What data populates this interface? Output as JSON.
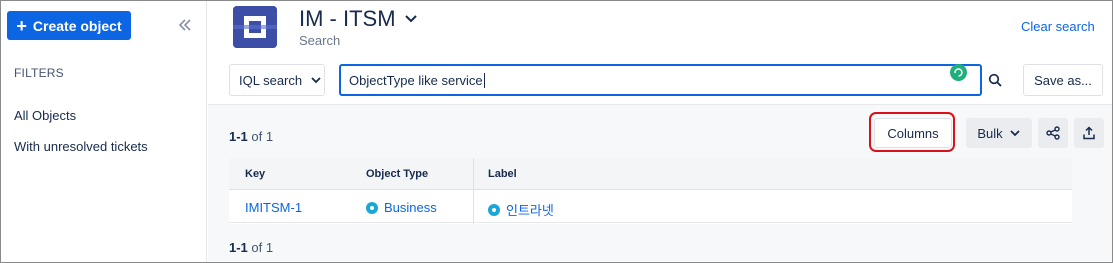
{
  "sidebar": {
    "create_label": "Create object",
    "filters_title": "FILTERS",
    "items": [
      {
        "label": "All Objects"
      },
      {
        "label": "With unresolved tickets"
      }
    ]
  },
  "header": {
    "title": "IM - ITSM",
    "subtitle": "Search",
    "clear_search": "Clear search"
  },
  "search": {
    "mode": "IQL search",
    "query": "ObjectType like service",
    "save_as": "Save as..."
  },
  "results": {
    "count_top": {
      "range": "1-1",
      "total": "of 1"
    },
    "count_bottom": {
      "range": "1-1",
      "total": "of 1"
    },
    "columns_label": "Columns",
    "bulk_label": "Bulk",
    "table": {
      "headers": [
        "Key",
        "Object Type",
        "Label"
      ],
      "rows": [
        {
          "key": "IMITSM-1",
          "type": "Business",
          "label": "인트라넷"
        }
      ]
    }
  },
  "colors": {
    "primary": "#0c66e4",
    "highlight": "#d9111a",
    "avatar": "#3d4ea6",
    "type_icon": "#1aa7d8"
  },
  "icons": [
    "plus-icon",
    "double-chevron-left-icon",
    "chevron-down-icon",
    "search-icon",
    "share-icon",
    "export-icon",
    "object-type-icon"
  ]
}
